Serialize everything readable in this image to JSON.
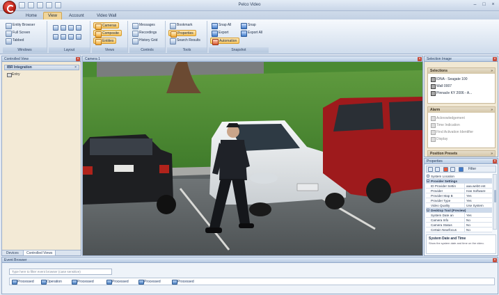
{
  "window": {
    "title": "Pelco Video",
    "minimize": "–",
    "maximize": "□",
    "close": "×"
  },
  "tabs": [
    {
      "label": "Home",
      "active": false
    },
    {
      "label": "View",
      "active": true
    },
    {
      "label": "Account",
      "active": false
    },
    {
      "label": "Video Wall",
      "active": false
    }
  ],
  "ribbon": {
    "groups": [
      {
        "label": "Windows"
      },
      {
        "label": "Layout"
      },
      {
        "label": "Views"
      },
      {
        "label": "Controls"
      },
      {
        "label": "Snapshot"
      },
      {
        "label": "Tools"
      }
    ],
    "windows": {
      "entity_browser": "Entity Browser",
      "full_screen": "Full Screen",
      "tabbed": "Tabbed"
    },
    "views": {
      "camera": "Cameras",
      "composite": "Composite",
      "entities": "Entities"
    },
    "controls": {
      "messages": "Messages",
      "recordings": "Recordings",
      "history_grid": "History Grid"
    },
    "tools": {
      "bookmark": "Bookmark",
      "properties": "Properties",
      "search_results": "Search Results"
    },
    "snapshot": {
      "snap_all": "Snap All",
      "export": "Export",
      "automation": "Automation"
    },
    "misc": {
      "snap": "Snap",
      "export_all": "Export All"
    }
  },
  "left_panel": {
    "title": "Controlled View",
    "header": "IBR Integration",
    "header_close": "×",
    "item": "Entry",
    "bottom_tabs": [
      "Devices",
      "Controlled Views"
    ]
  },
  "video_panel": {
    "title": "Camera 1"
  },
  "selection_panel": {
    "title": "Selection Image",
    "groups": [
      {
        "title": "Selections",
        "items": [
          "IDNA - Seagate 100",
          "Wall 0007",
          "Pinnacle KY 2006 - A..."
        ]
      },
      {
        "title": "Alarm",
        "items": [
          "Acknowledgement",
          "Time Indication",
          "Find Activation Identifier",
          "Display"
        ]
      },
      {
        "title": "Position Presets",
        "items": []
      }
    ]
  },
  "properties": {
    "title": "Properties",
    "filter": "Filter",
    "rows": [
      {
        "k": "System Location",
        "v": "",
        "cat": false
      },
      {
        "k": "Provider Settings",
        "v": "",
        "cat": true
      },
      {
        "k": "ID Provider Settin",
        "v": "aaa.web0 ent",
        "cat": false
      },
      {
        "k": "Provider",
        "v": "Has Software",
        "cat": false
      },
      {
        "k": "Provider Map B",
        "v": "Yes",
        "cat": false
      },
      {
        "k": "Provider Type",
        "v": "Yes",
        "cat": false
      },
      {
        "k": "Video Quality",
        "v": "Use System",
        "cat": false
      },
      {
        "k": "Desktop Tool (Preview)",
        "v": "",
        "cat": true
      },
      {
        "k": "System Date an",
        "v": "Yes",
        "cat": false
      },
      {
        "k": "Camera Info",
        "v": "No",
        "cat": false
      },
      {
        "k": "Camera Status",
        "v": "No",
        "cat": false
      },
      {
        "k": "Certain Nearfocus",
        "v": "No",
        "cat": false
      }
    ],
    "desc_title": "System Date and Time",
    "desc_text": "Show the system date and time on the video."
  },
  "events": {
    "title": "Event Browser",
    "filter_placeholder": "Type here to filter event browser (case sensitive)",
    "chips": [
      "Processed",
      "Operation",
      "Processed",
      "Processed",
      "Processed",
      "Processed"
    ]
  },
  "colors": {
    "accent": "#f0d59a",
    "panel_header": "#b8cbe3",
    "close": "#c54a3a"
  }
}
